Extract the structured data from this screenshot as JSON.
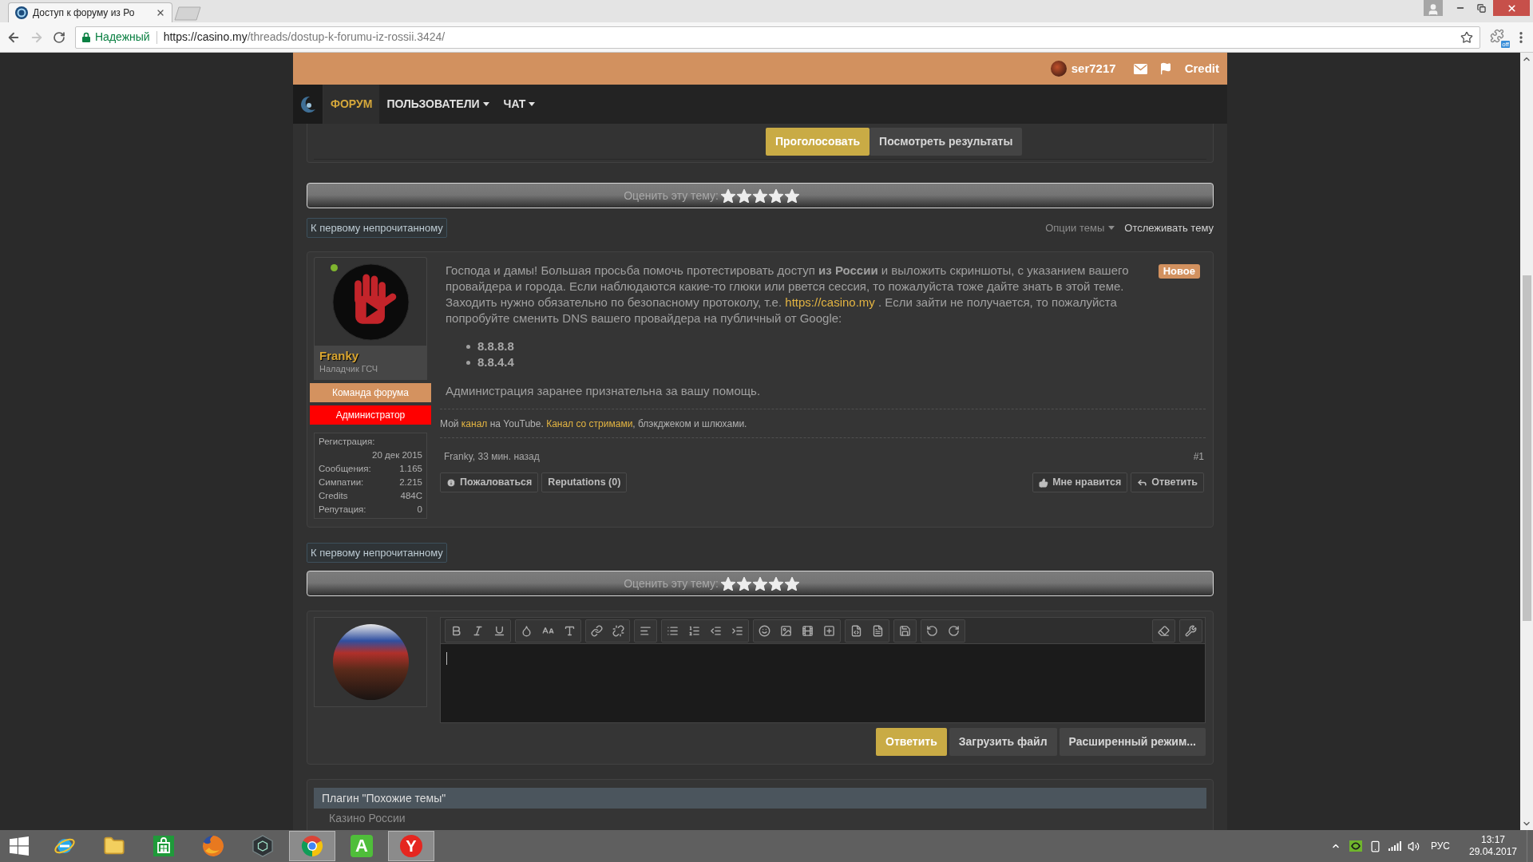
{
  "browser": {
    "tab_title": "Доступ к форуму из Ро",
    "forward_disabled": true,
    "security_label": "Надежный",
    "url": {
      "host": "https://casino.my",
      "path": "/threads/dostup-k-forumu-iz-rossii.3424/"
    },
    "extension_badge": "off"
  },
  "header": {
    "username": "ser7217",
    "credit": "Credit"
  },
  "nav": {
    "tabs": [
      {
        "label": "ФОРУМ",
        "selected": true,
        "dropdown": false
      },
      {
        "label": "ПОЛЬЗОВАТЕЛИ",
        "selected": false,
        "dropdown": true
      },
      {
        "label": "ЧАТ",
        "selected": false,
        "dropdown": true
      }
    ]
  },
  "poll": {
    "buttons": [
      {
        "label": "Проголосовать",
        "kind": "primary"
      },
      {
        "label": "Посмотреть результаты",
        "kind": "secondary"
      }
    ]
  },
  "rating_top": {
    "label": "Оценить эту тему:",
    "stars": 5
  },
  "thread_tools": {
    "first_unread": "К первому непрочитанному",
    "options": "Опции темы",
    "watch": "Отслеживать тему"
  },
  "post": {
    "author": {
      "name": "Franky",
      "title": "Наладчик ГСЧ",
      "online": true,
      "banners": [
        {
          "label": "Команда форума",
          "color": "#d4925f"
        },
        {
          "label": "Администратор",
          "color": "#ff0000"
        }
      ],
      "stats": [
        {
          "label": "Регистрация:",
          "value": "20 дек 2015",
          "kind": "stacked"
        },
        {
          "label": "Сообщения:",
          "value": "1.165",
          "kind": "inline"
        },
        {
          "label": "Симпатии:",
          "value": "2.215",
          "kind": "inline"
        },
        {
          "label": "Credits",
          "value": "484C",
          "kind": "inline"
        },
        {
          "label": "Репутация:",
          "value": "0",
          "kind": "inline"
        }
      ]
    },
    "badge": "Новое",
    "body": [
      {
        "kind": "paragraph",
        "segments": [
          {
            "kind": "text",
            "text": "Господа и дамы! Большая просьба помочь протестировать доступ **из России** и выложить скриншоты, с указанием вашего провайдера и города. Если наблюдаются какие-то глюки или рвется сессия, то пожалуйста тоже дайте знать в этой теме. Заходить нужно обязательно по безопасному протоколу, т.е. "
          },
          {
            "kind": "link",
            "text": "https://casino.my"
          },
          {
            "kind": "text",
            "text": " . Если зайти не получается, то пожалуйста попробуйте сменить DNS вашего провайдера на публичный от Google:"
          }
        ]
      },
      {
        "kind": "list",
        "items": [
          "8.8.8.8",
          "8.8.4.4"
        ]
      },
      {
        "kind": "paragraph",
        "segments": [
          {
            "kind": "text",
            "text": "Администрация заранее признательна за вашу помощь."
          }
        ]
      }
    ],
    "signature": [
      {
        "kind": "text",
        "text": "Мой "
      },
      {
        "kind": "link",
        "text": "канал"
      },
      {
        "kind": "text",
        "text": " на YouTube. "
      },
      {
        "kind": "link",
        "text": "Канал со стримами"
      },
      {
        "kind": "text",
        "text": ", блэкджеком и шлюхами."
      }
    ],
    "byline": "Franky, 33 мин. назад",
    "number": "#1",
    "actions_left": [
      "Пожаловаться",
      "Reputations (0)"
    ],
    "actions_right": [
      "Мне нравится",
      "Ответить"
    ]
  },
  "thread_tools_bottom": {
    "first_unread": "К первому непрочитанному"
  },
  "rating_bottom": {
    "label": "Оценить эту тему:",
    "stars": 5
  },
  "reply_form": {
    "buttons": [
      {
        "label": "Ответить",
        "kind": "primary"
      },
      {
        "label": "Загрузить файл",
        "kind": "secondary"
      },
      {
        "label": "Расширенный режим...",
        "kind": "secondary"
      }
    ]
  },
  "similar_threads": {
    "title": "Плагин \"Похожие темы\"",
    "items": [
      "Казино России"
    ]
  },
  "taskbar": {
    "apps": [
      {
        "kind": "ie",
        "open": false
      },
      {
        "kind": "explorer",
        "open": false
      },
      {
        "kind": "store",
        "open": false
      },
      {
        "kind": "firefox",
        "open": false
      },
      {
        "kind": "nox",
        "open": false
      },
      {
        "kind": "chrome",
        "open": true
      },
      {
        "kind": "letter_tile",
        "glyph": "A",
        "open": false
      },
      {
        "kind": "letter_disc",
        "glyph": "Y",
        "open": true
      }
    ],
    "language": "РУС",
    "time": "13:17",
    "date": "29.04.2017"
  }
}
